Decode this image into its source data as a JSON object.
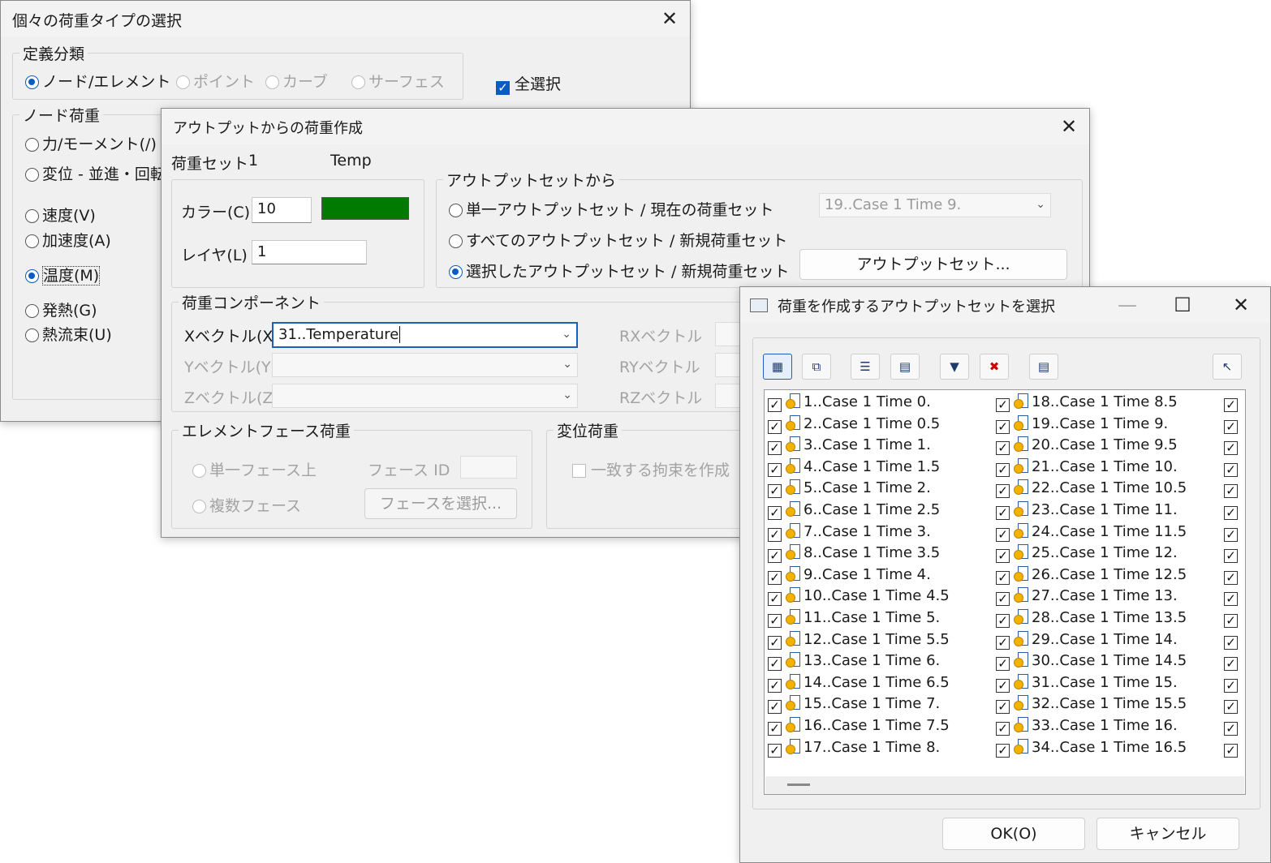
{
  "dlg1": {
    "title": "個々の荷重タイプの選択",
    "close": "✕",
    "group_def": "定義分類",
    "def_options": [
      "ノード/エレメント",
      "ポイント",
      "カーブ",
      "サーフェス"
    ],
    "select_all": "全選択",
    "group_node": "ノード荷重",
    "node_options": [
      "力/モーメント(/)",
      "変位 - 並進・回転",
      "速度(V)",
      "加速度(A)",
      "温度(M)",
      "発熱(G)",
      "熱流束(U)"
    ]
  },
  "dlg2": {
    "title": "アウトプットからの荷重作成",
    "close": "✕",
    "loadset_label": "荷重セット",
    "loadset_id": "1",
    "loadset_name": "Temp",
    "color_label": "カラー(C)",
    "color_value": "10",
    "color_swatch": "#007a00",
    "layer_label": "レイヤ(L)",
    "layer_value": "1",
    "group_from": "アウトプットセットから",
    "from_options": [
      "単一アウトプットセット / 現在の荷重セット",
      "すべてのアウトプットセット / 新規荷重セット",
      "選択したアウトプットセット / 新規荷重セット"
    ],
    "current_set": "19..Case 1 Time 9.",
    "output_sets_button": "アウトプットセット...",
    "group_component": "荷重コンポーネント",
    "x_vector_label": "Xベクトル(X)",
    "x_vector_value": "31..Temperature",
    "y_vector_label": "Yベクトル(Y)",
    "z_vector_label": "Zベクトル(Z)",
    "rx_label": "RXベクトル",
    "ry_label": "RYベクトル",
    "rz_label": "RZベクトル",
    "group_face": "エレメントフェース荷重",
    "single_face": "単一フェース上",
    "face_id_label": "フェース ID",
    "multi_face": "複数フェース",
    "select_face_button": "フェースを選択...",
    "group_disp": "変位荷重",
    "match_constraint": "一致する拘束を作成"
  },
  "dlg3": {
    "title": "荷重を作成するアウトプットセットを選択",
    "minimize": "—",
    "maximize": "☐",
    "close": "✕",
    "ok_button": "OK(O)",
    "cancel_button": "キャンセル",
    "col1": [
      "1..Case 1 Time 0.",
      "2..Case 1 Time 0.5",
      "3..Case 1 Time 1.",
      "4..Case 1 Time 1.5",
      "5..Case 1 Time 2.",
      "6..Case 1 Time 2.5",
      "7..Case 1 Time 3.",
      "8..Case 1 Time 3.5",
      "9..Case 1 Time 4.",
      "10..Case 1 Time 4.5",
      "11..Case 1 Time 5.",
      "12..Case 1 Time 5.5",
      "13..Case 1 Time 6.",
      "14..Case 1 Time 6.5",
      "15..Case 1 Time 7.",
      "16..Case 1 Time 7.5",
      "17..Case 1 Time 8."
    ],
    "col2": [
      "18..Case 1 Time 8.5",
      "19..Case 1 Time 9.",
      "20..Case 1 Time 9.5",
      "21..Case 1 Time 10.",
      "22..Case 1 Time 10.5",
      "23..Case 1 Time 11.",
      "24..Case 1 Time 11.5",
      "25..Case 1 Time 12.",
      "26..Case 1 Time 12.5",
      "27..Case 1 Time 13.",
      "28..Case 1 Time 13.5",
      "29..Case 1 Time 14.",
      "30..Case 1 Time 14.5",
      "31..Case 1 Time 15.",
      "32..Case 1 Time 15.5",
      "33..Case 1 Time 16.",
      "34..Case 1 Time 16.5"
    ],
    "check_mark": "✓"
  }
}
